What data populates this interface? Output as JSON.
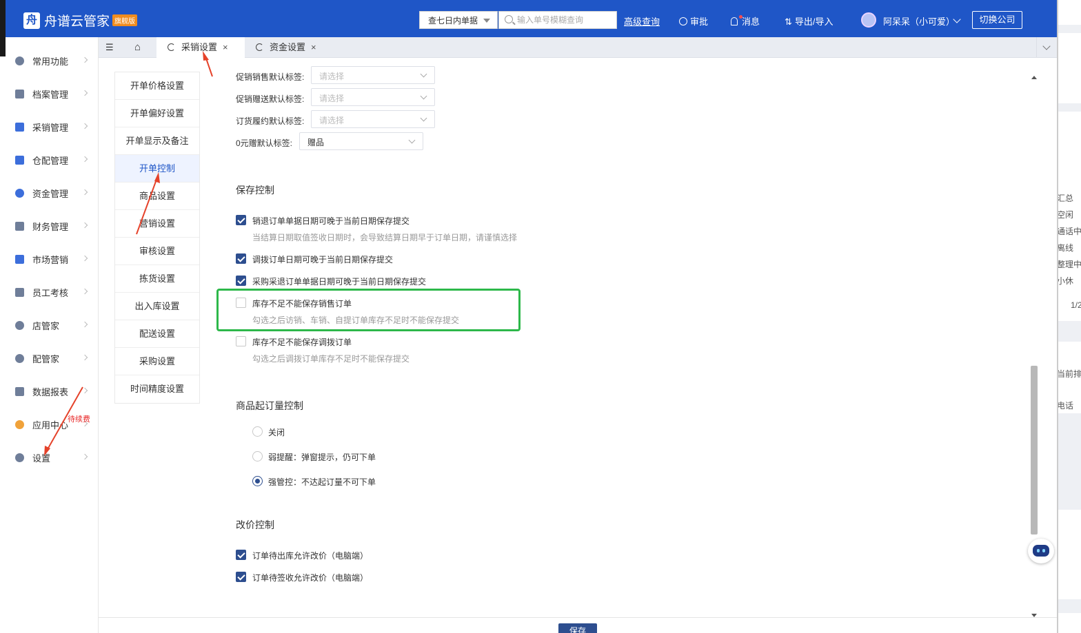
{
  "header": {
    "app_name": "舟谱云管家",
    "edition_badge": "旗舰版",
    "range_select": "查七日内单据",
    "search_placeholder": "输入单号模糊查询",
    "advanced_query": "高级查询",
    "approve": "审批",
    "messages": "消息",
    "export_import": "导出/导入",
    "user_name": "阿呆呆（小可爱）",
    "switch_company": "切换公司"
  },
  "sidebar": {
    "items": [
      {
        "label": "常用功能",
        "icon": "star-icon"
      },
      {
        "label": "档案管理",
        "icon": "grid-icon"
      },
      {
        "label": "采销管理",
        "icon": "clipboard-icon"
      },
      {
        "label": "仓配管理",
        "icon": "warehouse-icon"
      },
      {
        "label": "资金管理",
        "icon": "money-icon"
      },
      {
        "label": "财务管理",
        "icon": "calculator-icon"
      },
      {
        "label": "市场营销",
        "icon": "store-icon"
      },
      {
        "label": "员工考核",
        "icon": "users-icon"
      },
      {
        "label": "店管家",
        "icon": "shop-icon"
      },
      {
        "label": "配管家",
        "icon": "delivery-icon"
      },
      {
        "label": "数据报表",
        "icon": "chart-icon"
      },
      {
        "label": "应用中心",
        "icon": "apps-icon"
      },
      {
        "label": "设置",
        "icon": "gear-icon"
      }
    ],
    "renew_badge": "待续费"
  },
  "tabs": [
    {
      "label": "采销设置"
    },
    {
      "label": "资金设置"
    }
  ],
  "subnav": [
    "开单价格设置",
    "开单偏好设置",
    "开单显示及备注",
    "开单控制",
    "商品设置",
    "营销设置",
    "审核设置",
    "拣货设置",
    "出入库设置",
    "配送设置",
    "采购设置",
    "时间精度设置"
  ],
  "labels_section": {
    "fields": [
      {
        "label": "促销销售默认标签:",
        "value": "请选择"
      },
      {
        "label": "促销赠送默认标签:",
        "value": "请选择"
      },
      {
        "label": "订货履约默认标签:",
        "value": "请选择"
      },
      {
        "label": "0元赠默认标签:",
        "value": "赠品"
      }
    ]
  },
  "save_control": {
    "title": "保存控制",
    "items": [
      {
        "label": "销退订单单据日期可晚于当前日期保存提交",
        "checked": true,
        "hint": "当结算日期取值签收日期时，会导致结算日期早于订单日期，请谨慎选择"
      },
      {
        "label": "调拨订单日期可晚于当前日期保存提交",
        "checked": true,
        "hint": ""
      },
      {
        "label": "采购采退订单单据日期可晚于当前日期保存提交",
        "checked": true,
        "hint": ""
      },
      {
        "label": "库存不足不能保存销售订单",
        "checked": false,
        "hint": "勾选之后访销、车销、自提订单库存不足时不能保存提交"
      },
      {
        "label": "库存不足不能保存调拨订单",
        "checked": false,
        "hint": "勾选之后调拨订单库存不足时不能保存提交"
      }
    ]
  },
  "moq_control": {
    "title": "商品起订量控制",
    "options": [
      {
        "label": "关闭",
        "selected": false
      },
      {
        "label": "弱提醒：弹窗提示，仍可下单",
        "selected": false
      },
      {
        "label": "强管控：不达起订量不可下单",
        "selected": true
      }
    ]
  },
  "price_control": {
    "title": "改价控制",
    "items": [
      {
        "label": "订单待出库允许改价（电脑端）",
        "checked": true
      },
      {
        "label": "订单待签收允许改价（电脑端）",
        "checked": true
      }
    ]
  },
  "save_button": "保存",
  "background_window": {
    "fragments": [
      "汇总",
      "空闲",
      "通话中",
      "离线",
      "整理中",
      "小休",
      "1/2",
      "当前排队",
      "电话"
    ]
  },
  "colors": {
    "brand_blue": "#1f56c7",
    "checkbox_blue": "#2d4e8f",
    "highlight_green": "#2db84a",
    "annotation_red": "#e5422a"
  }
}
